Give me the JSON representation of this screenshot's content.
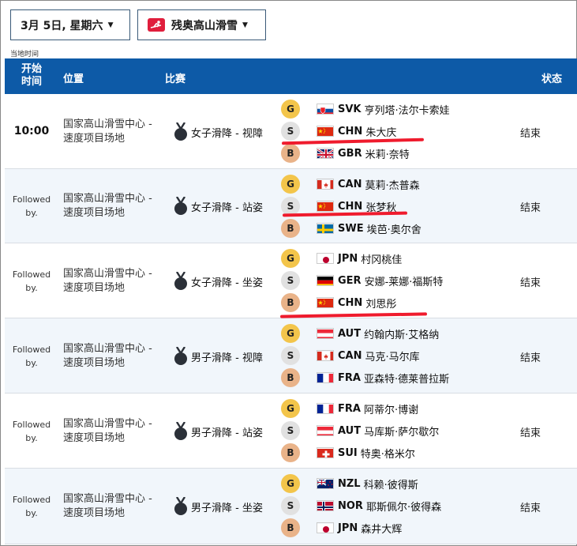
{
  "controls": {
    "date_label": "3月 5日, 星期六",
    "sport_label": "残奥高山滑雪"
  },
  "local_time_note": "当地时间",
  "header": {
    "time": "开始时间",
    "time_line1": "开始",
    "time_line2": "时间",
    "location": "位置",
    "event": "比赛",
    "status": "状态"
  },
  "colors": {
    "header_bg": "#0d5aa7",
    "gold": "#f3c54b",
    "silver": "#e1e1e1",
    "bronze": "#e9b389",
    "annotation": "#ef1b2d"
  },
  "rows": [
    {
      "time": "10:00",
      "location_line1": "国家高山滑雪中心 -",
      "location_line2": "速度项目场地",
      "event": "女子滑降 - 视障",
      "status": "结束",
      "results": [
        {
          "medal": "G",
          "flag": "svk",
          "noc": "SVK",
          "athlete": "亨列塔·法尔卡索娃"
        },
        {
          "medal": "S",
          "flag": "chn",
          "noc": "CHN",
          "athlete": "朱大庆"
        },
        {
          "medal": "B",
          "flag": "gbr",
          "noc": "GBR",
          "athlete": "米莉·奈特"
        }
      ]
    },
    {
      "time": "Followed by.",
      "time_line1": "Followed",
      "time_line2": "by.",
      "location_line1": "国家高山滑雪中心 -",
      "location_line2": "速度项目场地",
      "event": "女子滑降 - 站姿",
      "status": "结束",
      "results": [
        {
          "medal": "G",
          "flag": "can",
          "noc": "CAN",
          "athlete": "莫莉·杰普森"
        },
        {
          "medal": "S",
          "flag": "chn",
          "noc": "CHN",
          "athlete": "张梦秋"
        },
        {
          "medal": "B",
          "flag": "swe",
          "noc": "SWE",
          "athlete": "埃芭·奥尔舍"
        }
      ]
    },
    {
      "time": "Followed by.",
      "time_line1": "Followed",
      "time_line2": "by.",
      "location_line1": "国家高山滑雪中心 -",
      "location_line2": "速度项目场地",
      "event": "女子滑降 - 坐姿",
      "status": "结束",
      "results": [
        {
          "medal": "G",
          "flag": "jpn",
          "noc": "JPN",
          "athlete": "村冈桃佳"
        },
        {
          "medal": "S",
          "flag": "ger",
          "noc": "GER",
          "athlete": "安娜-莱娜·福斯特"
        },
        {
          "medal": "B",
          "flag": "chn",
          "noc": "CHN",
          "athlete": "刘思彤"
        }
      ]
    },
    {
      "time": "Followed by.",
      "time_line1": "Followed",
      "time_line2": "by.",
      "location_line1": "国家高山滑雪中心 -",
      "location_line2": "速度项目场地",
      "event": "男子滑降 - 视障",
      "status": "结束",
      "results": [
        {
          "medal": "G",
          "flag": "aut",
          "noc": "AUT",
          "athlete": "约翰内斯·艾格纳"
        },
        {
          "medal": "S",
          "flag": "can",
          "noc": "CAN",
          "athlete": "马克·马尔库"
        },
        {
          "medal": "B",
          "flag": "fra",
          "noc": "FRA",
          "athlete": "亚森特·德莱普拉斯"
        }
      ]
    },
    {
      "time": "Followed by.",
      "time_line1": "Followed",
      "time_line2": "by.",
      "location_line1": "国家高山滑雪中心 -",
      "location_line2": "速度项目场地",
      "event": "男子滑降 - 站姿",
      "status": "结束",
      "results": [
        {
          "medal": "G",
          "flag": "fra",
          "noc": "FRA",
          "athlete": "阿蒂尔·博谢"
        },
        {
          "medal": "S",
          "flag": "aut",
          "noc": "AUT",
          "athlete": "马库斯·萨尔歇尔"
        },
        {
          "medal": "B",
          "flag": "sui",
          "noc": "SUI",
          "athlete": "特奥·格米尔"
        }
      ]
    },
    {
      "time": "Followed by.",
      "time_line1": "Followed",
      "time_line2": "by.",
      "location_line1": "国家高山滑雪中心 -",
      "location_line2": "速度项目场地",
      "event": "男子滑降 - 坐姿",
      "status": "结束",
      "results": [
        {
          "medal": "G",
          "flag": "nzl",
          "noc": "NZL",
          "athlete": "科赖·彼得斯"
        },
        {
          "medal": "S",
          "flag": "nor",
          "noc": "NOR",
          "athlete": "耶斯佩尔·彼得森"
        },
        {
          "medal": "B",
          "flag": "jpn",
          "noc": "JPN",
          "athlete": "森井大辉"
        }
      ]
    }
  ]
}
